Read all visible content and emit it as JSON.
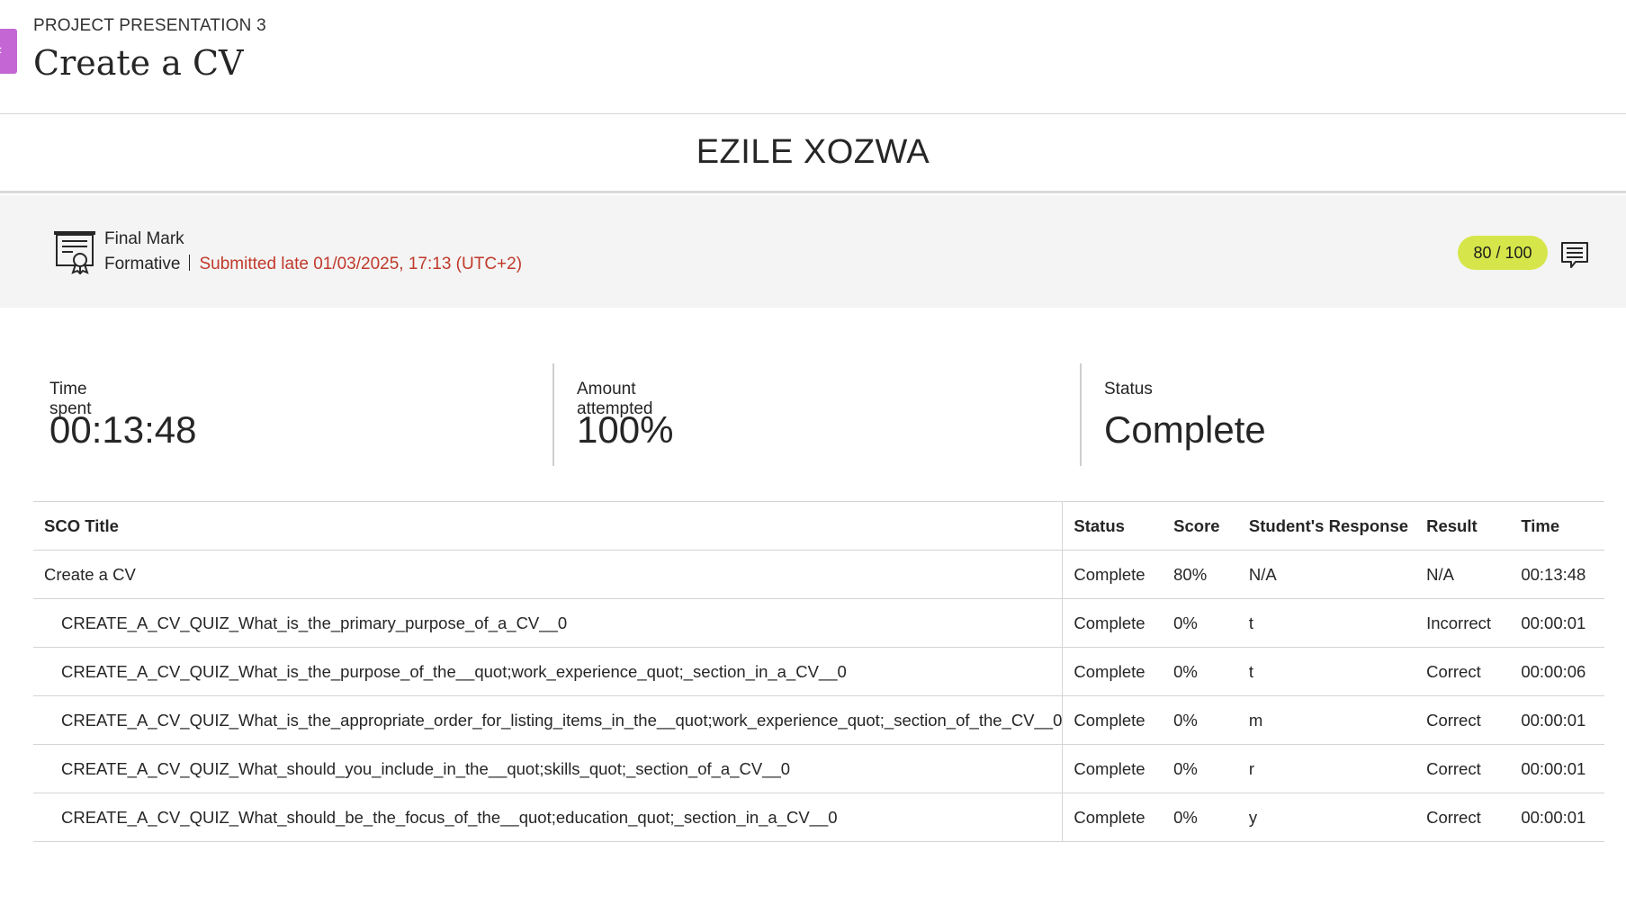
{
  "header": {
    "overline": "PROJECT PRESENTATION 3",
    "title": "Create a CV"
  },
  "student": {
    "name": "EZILE XOZWA"
  },
  "grade": {
    "title": "Final Mark",
    "type": "Formative",
    "submission": "Submitted late 01/03/2025, 17:13 (UTC+2)",
    "score": "80 / 100",
    "pill_color": "#d6e64a",
    "late_color": "#c0392b"
  },
  "stats": [
    {
      "label": "Time spent",
      "value": "00:13:48"
    },
    {
      "label": "Amount attempted",
      "value": "100%"
    },
    {
      "label": "Status",
      "value": "Complete"
    }
  ],
  "table": {
    "headers": [
      "SCO Title",
      "Status",
      "Score",
      "Student's Response",
      "Result",
      "Time"
    ],
    "rows": [
      [
        "Create a CV",
        "Complete",
        "80%",
        "N/A",
        "N/A",
        "00:13:48"
      ],
      [
        "CREATE_A_CV_QUIZ_What_is_the_primary_purpose_of_a_CV__0",
        "Complete",
        "0%",
        "t",
        "Incorrect",
        "00:00:01"
      ],
      [
        "CREATE_A_CV_QUIZ_What_is_the_purpose_of_the__quot;work_experience_quot;_section_in_a_CV__0",
        "Complete",
        "0%",
        "t",
        "Correct",
        "00:00:06"
      ],
      [
        "CREATE_A_CV_QUIZ_What_is_the_appropriate_order_for_listing_items_in_the__quot;work_experience_quot;_section_of_the_CV__0",
        "Complete",
        "0%",
        "m",
        "Correct",
        "00:00:01"
      ],
      [
        "CREATE_A_CV_QUIZ_What_should_you_include_in_the__quot;skills_quot;_section_of_a_CV__0",
        "Complete",
        "0%",
        "r",
        "Correct",
        "00:00:01"
      ],
      [
        "CREATE_A_CV_QUIZ_What_should_be_the_focus_of_the__quot;education_quot;_section_in_a_CV__0",
        "Complete",
        "0%",
        "y",
        "Correct",
        "00:00:01"
      ]
    ]
  }
}
